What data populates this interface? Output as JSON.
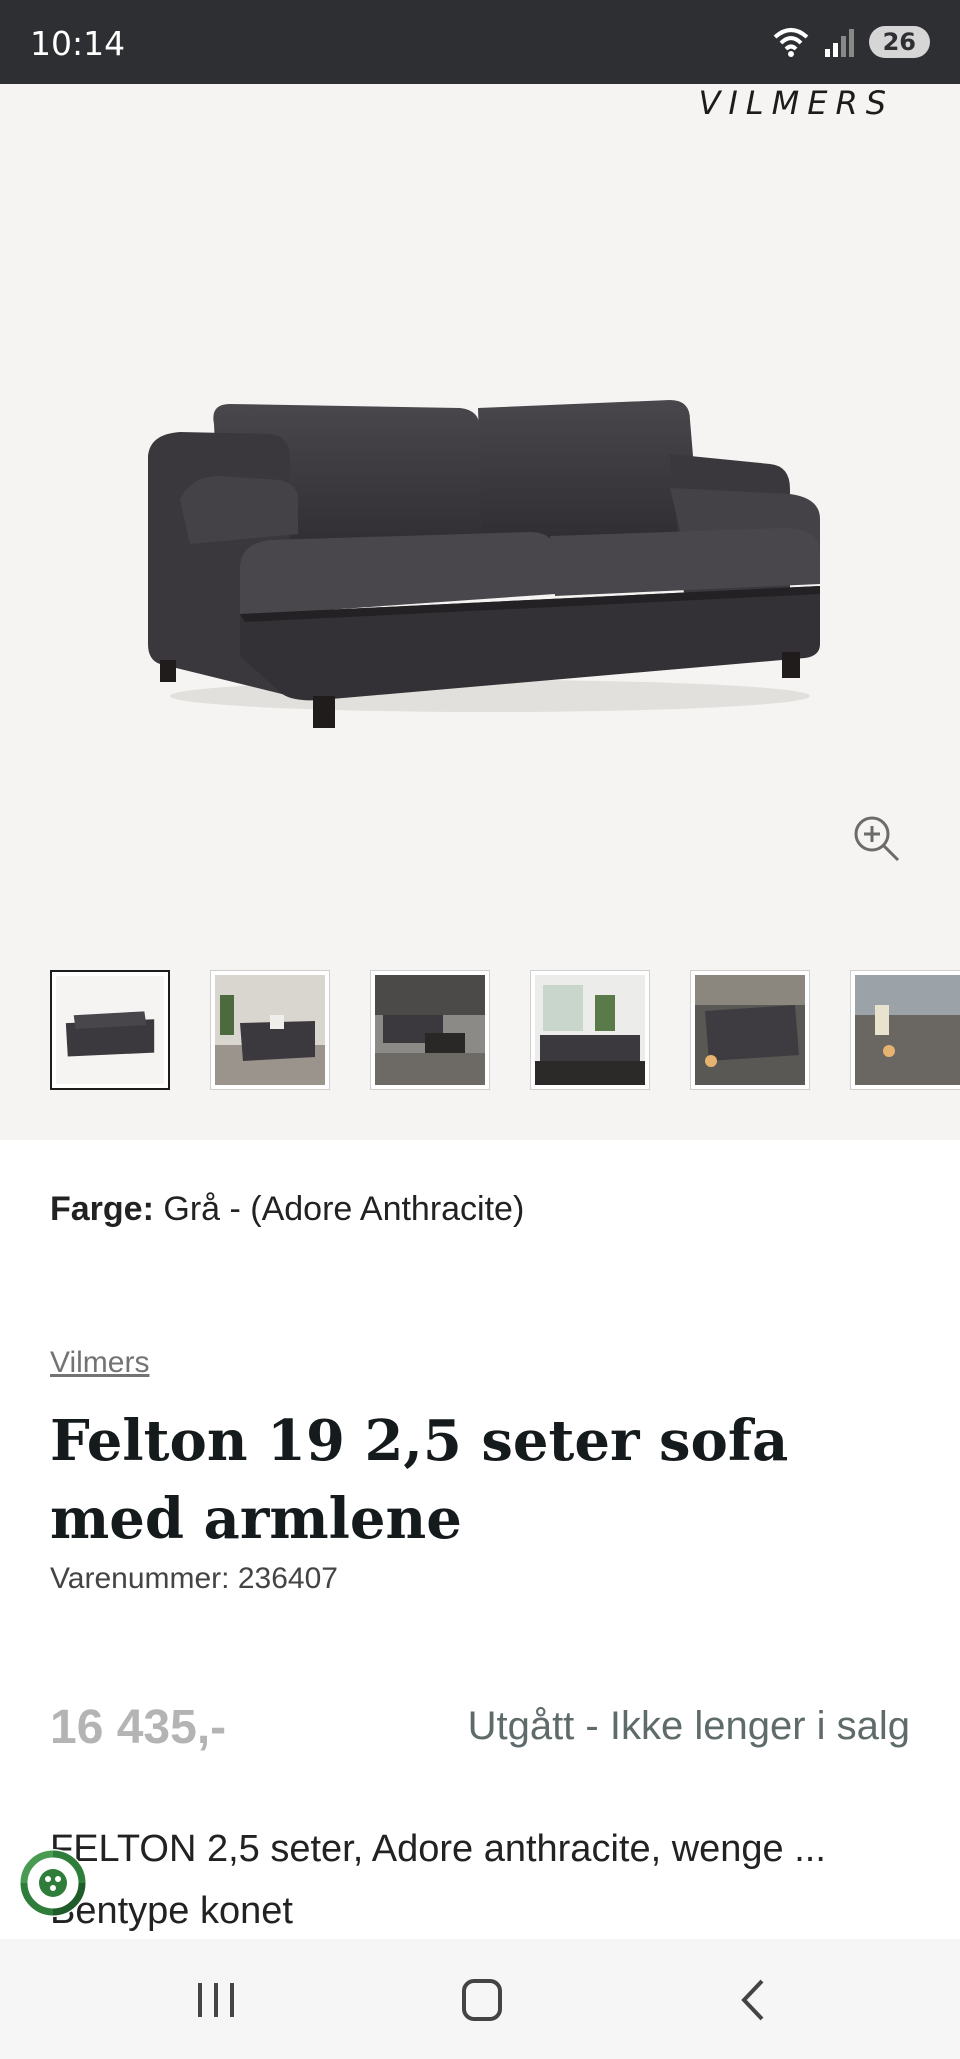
{
  "status_bar": {
    "time": "10:14",
    "battery": "26"
  },
  "brand_logo": "VILMERS",
  "gallery": {
    "thumbnail_count": 6,
    "selected_index": 0
  },
  "product": {
    "color_label": "Farge:",
    "color_value": "Grå - (Adore Anthracite)",
    "brand": "Vilmers",
    "title": "Felton 19 2,5 seter sofa med armlene",
    "sku": "Varenummer: 236407",
    "price": "16 435,-",
    "availability": "Utgått - Ikke lenger i salg",
    "description": "FELTON 2,5 seter, Adore anthracite, wenge ... Bentype konet"
  },
  "colors": {
    "status_bar_bg": "#2e2f33",
    "hero_bg": "#f5f4f2",
    "sofa": "#3b393d",
    "price": "#b4b4b4",
    "availability": "#5e6b6a",
    "eco_green": "#2f7d3a"
  },
  "icons": [
    "wifi-icon",
    "signal-icon",
    "zoom-in-icon",
    "eco-icon",
    "recent-apps-icon",
    "home-icon",
    "back-icon"
  ]
}
